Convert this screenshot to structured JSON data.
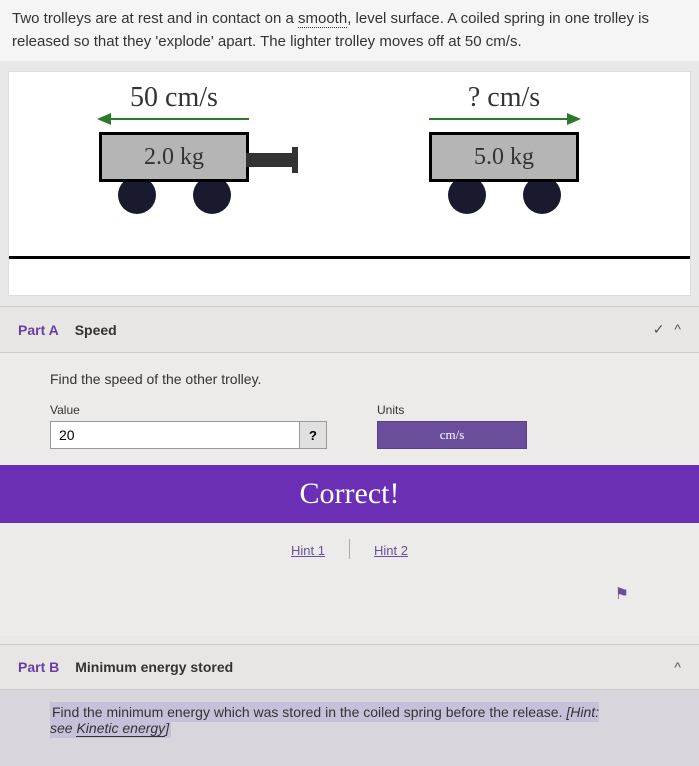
{
  "problem": {
    "line1_pre": "Two trolleys are at rest and in contact on a ",
    "smooth": "smooth",
    "line1_post": ", level surface. A coiled spring in one trolley is",
    "line2": "released so that they 'explode' apart. The lighter trolley moves off at 50 cm/s."
  },
  "diagram": {
    "left_velocity": "50 cm/s",
    "left_mass": "2.0 kg",
    "right_velocity": "? cm/s",
    "right_mass": "5.0 kg"
  },
  "partA": {
    "label": "Part A",
    "title": "Speed",
    "check": "✓",
    "caret": "^",
    "question": "Find the speed of the other trolley.",
    "value_label": "Value",
    "value": "20",
    "help": "?",
    "units_label": "Units",
    "units": "cm/s",
    "correct": "Correct!",
    "hint1": "Hint 1",
    "hint2": "Hint 2",
    "flag": "⚑"
  },
  "partB": {
    "label": "Part B",
    "title": "Minimum energy stored",
    "caret": "^",
    "question_pre": "Find the minimum energy which was stored in the coiled spring before the release. ",
    "hint_label": "[Hint:",
    "hint_see": "see ",
    "hint_term": "Kinetic energy",
    "hint_close": "]"
  }
}
